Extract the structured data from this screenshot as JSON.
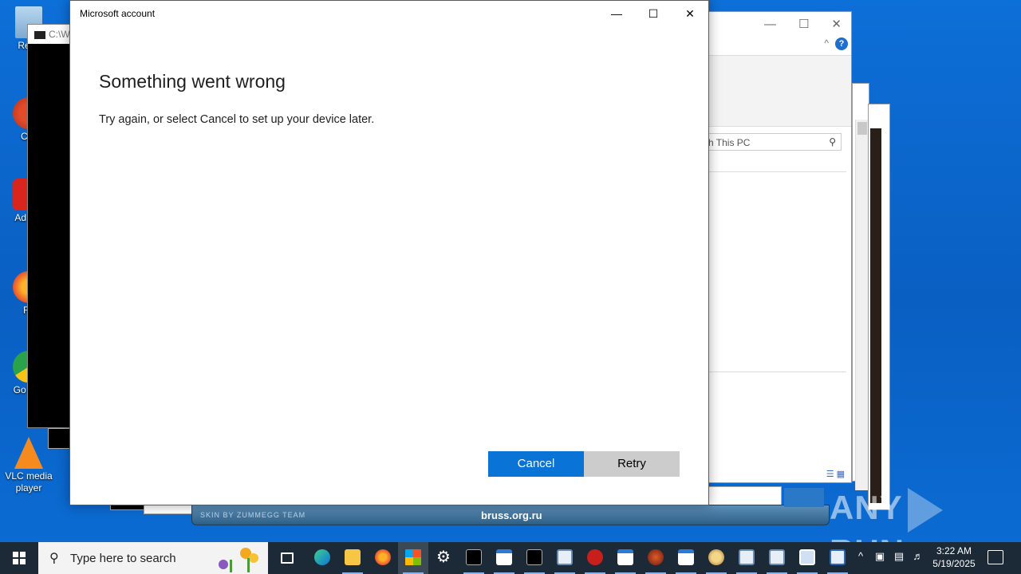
{
  "desktop": {
    "icons": [
      {
        "label": "Recy",
        "name": "recycle-bin-icon"
      },
      {
        "label": "CCl",
        "name": "ccleaner-icon"
      },
      {
        "label": "Ad Acr",
        "name": "adobe-acrobat-icon"
      },
      {
        "label": "Fir",
        "name": "firefox-desktop-icon"
      },
      {
        "label": "Go Chr",
        "name": "google-chrome-icon"
      },
      {
        "label": "VLC media player",
        "name": "vlc-media-player-icon"
      }
    ]
  },
  "cmd_window": {
    "title": "C:\\W"
  },
  "explorer": {
    "search_placeholder": "ch This PC"
  },
  "installer": {
    "left_text": "SKIN BY ZUMMEGG TEAM",
    "center_text": "bruss.org.ru"
  },
  "watermark": {
    "left": "ANY",
    "right": "RUN"
  },
  "dialog": {
    "title": "Microsoft account",
    "heading": "Something went wrong",
    "message": "Try again, or select Cancel to set up your device later.",
    "cancel_label": "Cancel",
    "retry_label": "Retry",
    "accent_color": "#0a73d6"
  },
  "taskbar": {
    "search_placeholder": "Type here to search",
    "apps": [
      "task-view",
      "edge",
      "file-explorer",
      "firefox",
      "microsoft-store",
      "settings",
      "cmd-1",
      "window-app-1",
      "cmd-2",
      "window-app-2",
      "acrobat",
      "window-app-3",
      "game",
      "window-app-4",
      "chrome-bubble",
      "window-app-5",
      "window-app-6",
      "magnifier",
      "installer"
    ],
    "time": "3:22 AM",
    "date": "5/19/2025"
  }
}
